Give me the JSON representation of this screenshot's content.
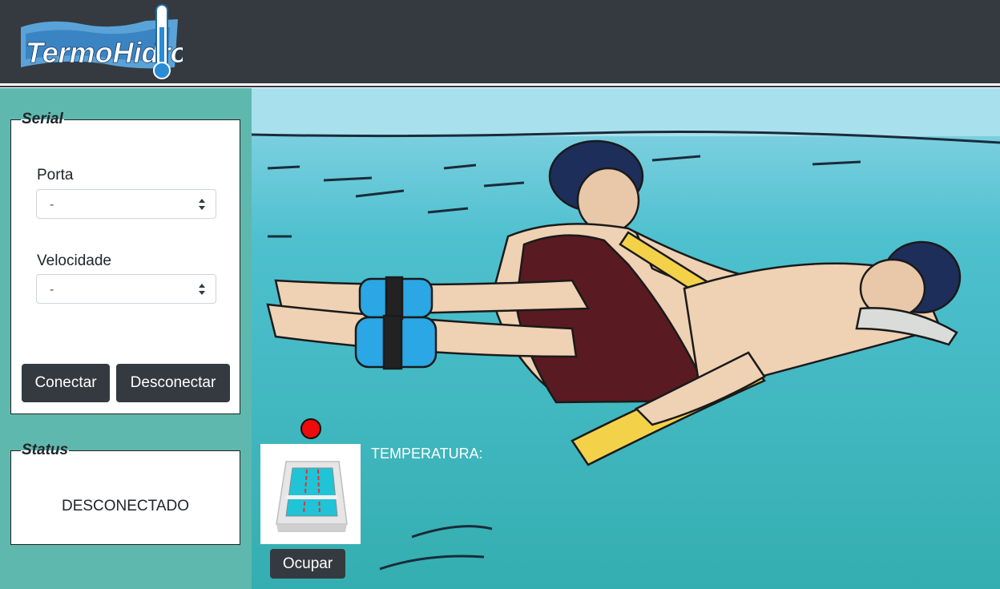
{
  "header": {
    "logo_text": "TermoHidro"
  },
  "serial": {
    "legend": "Serial",
    "port_label": "Porta",
    "port_value": "-",
    "speed_label": "Velocidade",
    "speed_value": "-",
    "connect_label": "Conectar",
    "disconnect_label": "Desconectar"
  },
  "status": {
    "legend": "Status",
    "value": "DESCONECTADO"
  },
  "pool": {
    "temperature_label": "TEMPERATURA:",
    "occupy_label": "Ocupar",
    "indicator_color": "#ee0b0b"
  },
  "colors": {
    "navbar": "#343a40",
    "sidebar": "#5fb8ae",
    "button": "#343a40"
  },
  "icons": {
    "logo": "thermometer-icon",
    "select": "chevron-up-down-icon",
    "pool": "swimming-pool-icon"
  }
}
